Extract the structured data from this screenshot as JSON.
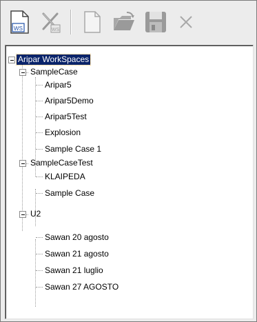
{
  "toolbar": {
    "buttons": [
      {
        "name": "new-workspace-button",
        "icon": "new-ws-icon",
        "enabled": true
      },
      {
        "name": "delete-workspace-button",
        "icon": "delete-ws-icon",
        "enabled": false
      },
      {
        "name": "new-case-button",
        "icon": "new-file-icon",
        "enabled": false
      },
      {
        "name": "open-case-button",
        "icon": "open-folder-icon",
        "enabled": false
      },
      {
        "name": "save-case-button",
        "icon": "save-icon",
        "enabled": false
      },
      {
        "name": "delete-case-button",
        "icon": "close-icon",
        "enabled": false
      }
    ],
    "icon_labels": {
      "ws": "WS"
    }
  },
  "tree": {
    "root": "Aripar WorkSpaces",
    "groups": [
      {
        "label": "SampleCase",
        "children": [
          "Aripar5",
          "Aripar5Demo",
          "Aripar5Test",
          "Explosion",
          "Sample Case 1"
        ]
      },
      {
        "label": "SampleCaseTest",
        "children": [
          "KLAIPEDA",
          "Sample Case"
        ]
      },
      {
        "label": "U2",
        "children": [
          "Sawan 20 agosto",
          "Sawan 21 agosto",
          "Sawan 21 luglio",
          "Sawan 27 AGOSTO"
        ]
      }
    ]
  },
  "colors": {
    "selection": "#0a246a",
    "disabled_icon": "#9a9a9a",
    "frame": "#ececec"
  }
}
